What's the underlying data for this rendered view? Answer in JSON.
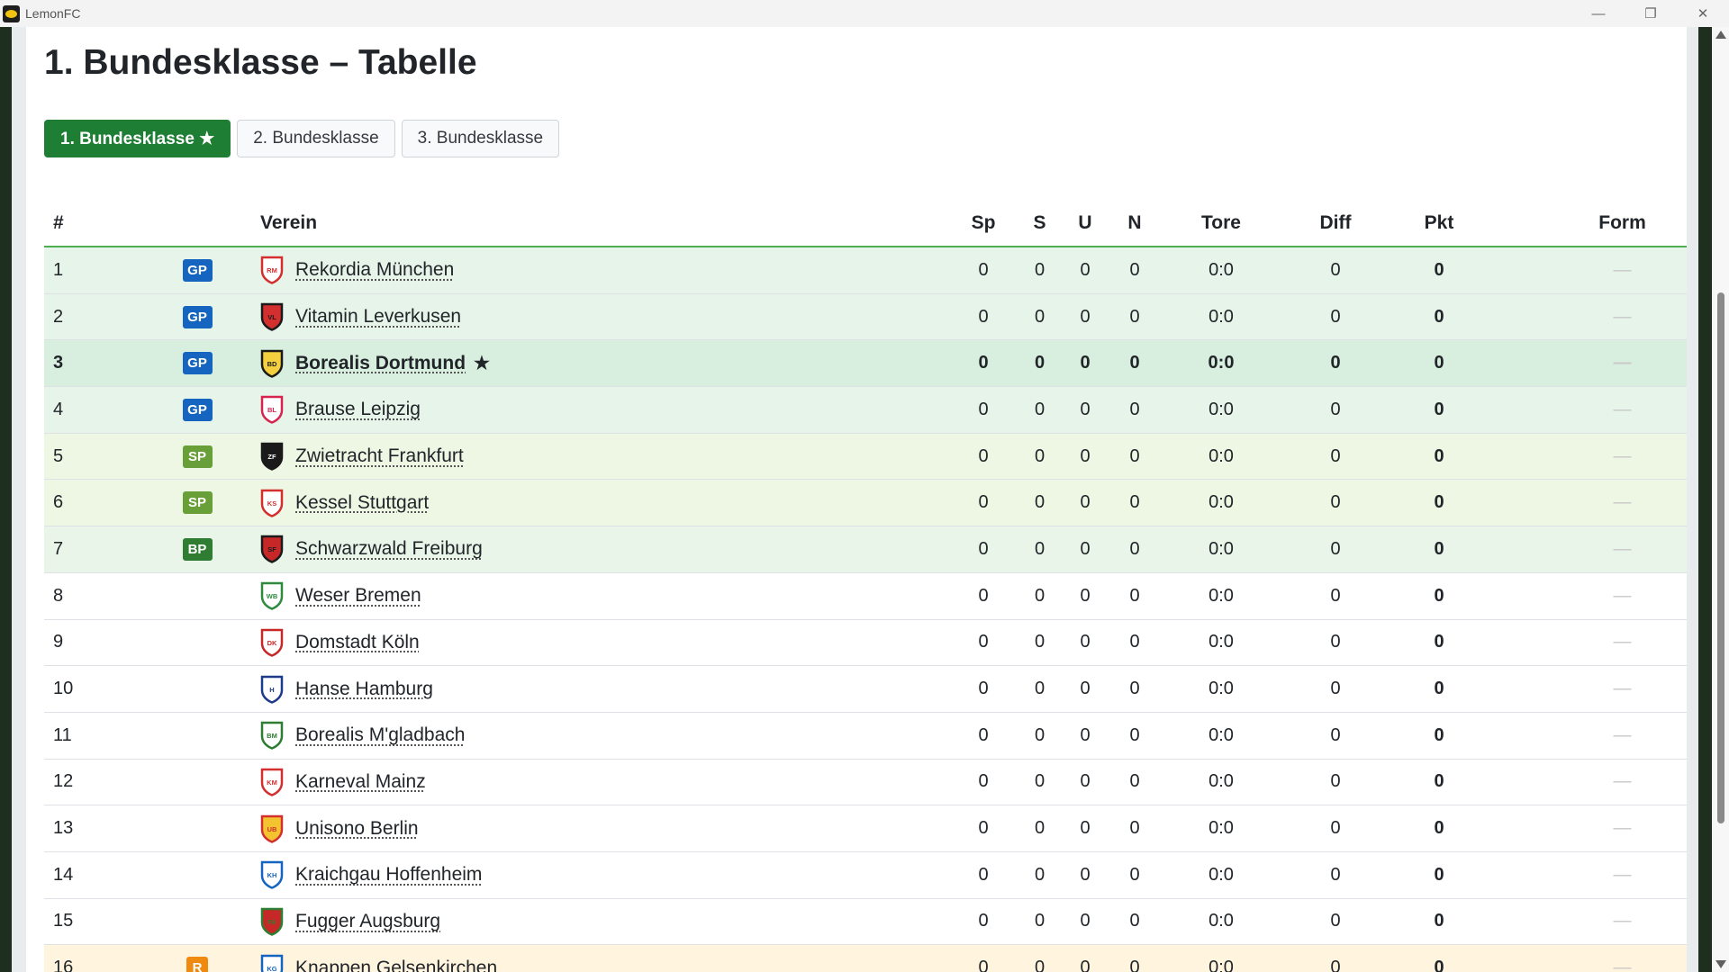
{
  "window": {
    "title": "LemonFC",
    "minimize": "—",
    "restore": "❐",
    "close": "✕"
  },
  "page": {
    "title": "1. Bundesklasse – Tabelle"
  },
  "tabs": [
    {
      "label": "1. Bundesklasse ★",
      "active": true
    },
    {
      "label": "2. Bundesklasse",
      "active": false
    },
    {
      "label": "3. Bundesklasse",
      "active": false
    }
  ],
  "table": {
    "headers": {
      "pos": "#",
      "zone": "",
      "club": "Verein",
      "sp": "Sp",
      "s": "S",
      "u": "U",
      "n": "N",
      "tore": "Tore",
      "diff": "Diff",
      "pkt": "Pkt",
      "form": "Form"
    },
    "own_marker": "★",
    "zone_colors": {
      "GP": "#1565c0",
      "SP": "#689f38",
      "BP": "#2e7d32",
      "R": "#ef8a0f"
    },
    "rows": [
      {
        "pos": "1",
        "zone": "GP",
        "club": "Rekordia München",
        "abbr": "RM",
        "crest": [
          "#ffffff",
          "#d32f2f"
        ],
        "sp": "0",
        "s": "0",
        "u": "0",
        "n": "0",
        "tore": "0:0",
        "diff": "0",
        "pkt": "0",
        "form": "—"
      },
      {
        "pos": "2",
        "zone": "GP",
        "club": "Vitamin Leverkusen",
        "abbr": "VL",
        "crest": [
          "#d32f2f",
          "#1a1a1a"
        ],
        "sp": "0",
        "s": "0",
        "u": "0",
        "n": "0",
        "tore": "0:0",
        "diff": "0",
        "pkt": "0",
        "form": "—"
      },
      {
        "pos": "3",
        "zone": "GP",
        "club": "Borealis Dortmund",
        "abbr": "BD",
        "crest": [
          "#f4d03f",
          "#1a1a1a"
        ],
        "sp": "0",
        "s": "0",
        "u": "0",
        "n": "0",
        "tore": "0:0",
        "diff": "0",
        "pkt": "0",
        "form": "—",
        "own": true
      },
      {
        "pos": "4",
        "zone": "GP",
        "club": "Brause Leipzig",
        "abbr": "BL",
        "crest": [
          "#ffffff",
          "#d6244f"
        ],
        "sp": "0",
        "s": "0",
        "u": "0",
        "n": "0",
        "tore": "0:0",
        "diff": "0",
        "pkt": "0",
        "form": "—"
      },
      {
        "pos": "5",
        "zone": "SP",
        "club": "Zwietracht Frankfurt",
        "abbr": "ZF",
        "crest": [
          "#1a1a1a",
          "#1a1a1a"
        ],
        "sp": "0",
        "s": "0",
        "u": "0",
        "n": "0",
        "tore": "0:0",
        "diff": "0",
        "pkt": "0",
        "form": "—"
      },
      {
        "pos": "6",
        "zone": "SP",
        "club": "Kessel Stuttgart",
        "abbr": "KS",
        "crest": [
          "#ffffff",
          "#d32f2f"
        ],
        "sp": "0",
        "s": "0",
        "u": "0",
        "n": "0",
        "tore": "0:0",
        "diff": "0",
        "pkt": "0",
        "form": "—"
      },
      {
        "pos": "7",
        "zone": "BP",
        "club": "Schwarzwald Freiburg",
        "abbr": "SF",
        "crest": [
          "#c62828",
          "#1a1a1a"
        ],
        "sp": "0",
        "s": "0",
        "u": "0",
        "n": "0",
        "tore": "0:0",
        "diff": "0",
        "pkt": "0",
        "form": "—"
      },
      {
        "pos": "8",
        "zone": "",
        "club": "Weser Bremen",
        "abbr": "WB",
        "crest": [
          "#ffffff",
          "#2e8b3e"
        ],
        "sp": "0",
        "s": "0",
        "u": "0",
        "n": "0",
        "tore": "0:0",
        "diff": "0",
        "pkt": "0",
        "form": "—"
      },
      {
        "pos": "9",
        "zone": "",
        "club": "Domstadt Köln",
        "abbr": "DK",
        "crest": [
          "#ffffff",
          "#c62828"
        ],
        "sp": "0",
        "s": "0",
        "u": "0",
        "n": "0",
        "tore": "0:0",
        "diff": "0",
        "pkt": "0",
        "form": "—"
      },
      {
        "pos": "10",
        "zone": "",
        "club": "Hanse Hamburg",
        "abbr": "H",
        "crest": [
          "#ffffff",
          "#1e3a8a"
        ],
        "sp": "0",
        "s": "0",
        "u": "0",
        "n": "0",
        "tore": "0:0",
        "diff": "0",
        "pkt": "0",
        "form": "—"
      },
      {
        "pos": "11",
        "zone": "",
        "club": "Borealis M'gladbach",
        "abbr": "BM",
        "crest": [
          "#ffffff",
          "#2e7d32"
        ],
        "sp": "0",
        "s": "0",
        "u": "0",
        "n": "0",
        "tore": "0:0",
        "diff": "0",
        "pkt": "0",
        "form": "—"
      },
      {
        "pos": "12",
        "zone": "",
        "club": "Karneval Mainz",
        "abbr": "KM",
        "crest": [
          "#ffffff",
          "#d32f2f"
        ],
        "sp": "0",
        "s": "0",
        "u": "0",
        "n": "0",
        "tore": "0:0",
        "diff": "0",
        "pkt": "0",
        "form": "—"
      },
      {
        "pos": "13",
        "zone": "",
        "club": "Unisono Berlin",
        "abbr": "UB",
        "crest": [
          "#f4c430",
          "#d32f2f"
        ],
        "sp": "0",
        "s": "0",
        "u": "0",
        "n": "0",
        "tore": "0:0",
        "diff": "0",
        "pkt": "0",
        "form": "—"
      },
      {
        "pos": "14",
        "zone": "",
        "club": "Kraichgau Hoffenheim",
        "abbr": "KH",
        "crest": [
          "#ffffff",
          "#1565c0"
        ],
        "sp": "0",
        "s": "0",
        "u": "0",
        "n": "0",
        "tore": "0:0",
        "diff": "0",
        "pkt": "0",
        "form": "—"
      },
      {
        "pos": "15",
        "zone": "",
        "club": "Fugger Augsburg",
        "abbr": "FA",
        "crest": [
          "#c62828",
          "#2e7d32"
        ],
        "sp": "0",
        "s": "0",
        "u": "0",
        "n": "0",
        "tore": "0:0",
        "diff": "0",
        "pkt": "0",
        "form": "—"
      },
      {
        "pos": "16",
        "zone": "R",
        "club": "Knappen Gelsenkirchen",
        "abbr": "KG",
        "crest": [
          "#ffffff",
          "#1565c0"
        ],
        "sp": "0",
        "s": "0",
        "u": "0",
        "n": "0",
        "tore": "0:0",
        "diff": "0",
        "pkt": "0",
        "form": "—"
      }
    ]
  }
}
